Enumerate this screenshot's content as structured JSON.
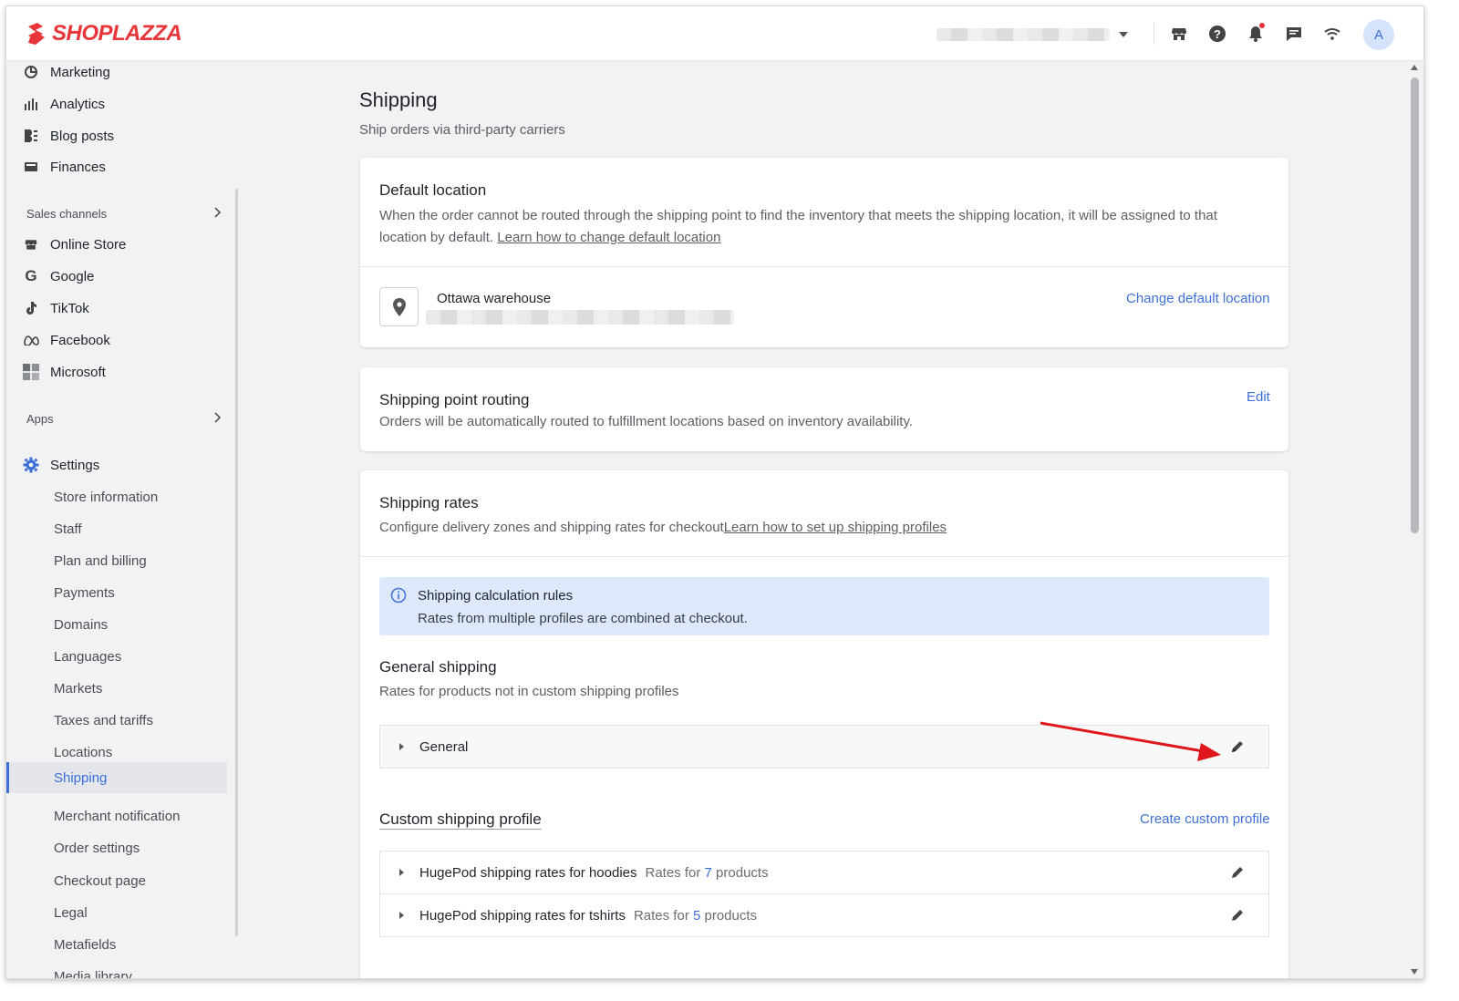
{
  "brand": {
    "name": "SHOPLAZZA",
    "color": "#e8353a",
    "accent": "#3d6fd8"
  },
  "topbar": {
    "icons": [
      "store-icon",
      "help-icon",
      "bell-icon",
      "chat-icon",
      "wifi-icon"
    ],
    "avatar_letter": "A"
  },
  "sidebar": {
    "top_items": [
      {
        "label": "Marketing",
        "icon": "marketing-icon"
      },
      {
        "label": "Analytics",
        "icon": "analytics-icon"
      },
      {
        "label": "Blog posts",
        "icon": "blog-icon"
      },
      {
        "label": "Finances",
        "icon": "finances-icon"
      }
    ],
    "sales_channels_label": "Sales channels",
    "channels": [
      {
        "label": "Online Store",
        "icon": "store-icon"
      },
      {
        "label": "Google",
        "icon": "google-icon"
      },
      {
        "label": "TikTok",
        "icon": "tiktok-icon"
      },
      {
        "label": "Facebook",
        "icon": "meta-icon"
      },
      {
        "label": "Microsoft",
        "icon": "microsoft-icon"
      }
    ],
    "apps_label": "Apps",
    "settings_label": "Settings",
    "settings_items": [
      "Store information",
      "Staff",
      "Plan and billing",
      "Payments",
      "Domains",
      "Languages",
      "Markets",
      "Taxes and tariffs",
      "Locations",
      "Shipping",
      "Merchant notification",
      "Order settings",
      "Checkout page",
      "Legal",
      "Metafields",
      "Media library"
    ],
    "active_item": "Shipping"
  },
  "page": {
    "title": "Shipping",
    "subtitle": "Ship orders via third-party carriers"
  },
  "default_location": {
    "title": "Default location",
    "text": "When the order cannot be routed through the shipping point to find the inventory that meets the shipping location, it will be assigned to that location by default.",
    "learn_link": "Learn how to change default location",
    "location_name": "Ottawa warehouse",
    "change_link": "Change default location"
  },
  "routing": {
    "title": "Shipping point routing",
    "text": "Orders will be automatically routed to fulfillment locations based on inventory availability.",
    "edit_link": "Edit"
  },
  "rates": {
    "title": "Shipping rates",
    "text": "Configure delivery zones and shipping rates for checkout",
    "learn_link": "Learn how to set up shipping profiles",
    "info_title": "Shipping calculation rules",
    "info_text": "Rates from multiple profiles are combined at checkout.",
    "general_title": "General shipping",
    "general_text": "Rates for products not in custom shipping profiles",
    "general_row": "General",
    "custom_title": "Custom shipping profile",
    "create_link": "Create custom profile",
    "profiles": [
      {
        "name": "HugePod shipping rates for hoodies",
        "rates_prefix": "Rates for",
        "count": "7",
        "rates_suffix": "products"
      },
      {
        "name": "HugePod shipping rates for tshirts",
        "rates_prefix": "Rates for",
        "count": "5",
        "rates_suffix": "products"
      }
    ]
  }
}
